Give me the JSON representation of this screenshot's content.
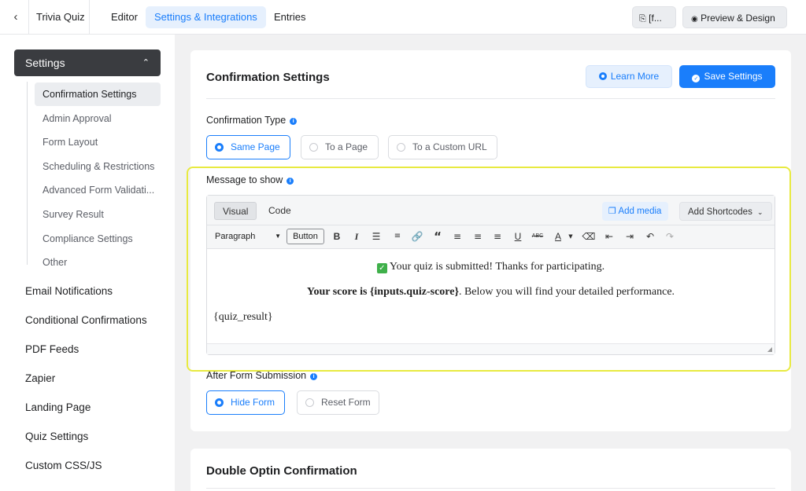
{
  "topbar": {
    "form_title": "Trivia Quiz",
    "nav": [
      "Editor",
      "Settings & Integrations",
      "Entries"
    ],
    "shortcode_btn": "[f...",
    "preview_btn": "Preview & Design"
  },
  "sidebar": {
    "settings_label": "Settings",
    "sub_items": [
      "Confirmation Settings",
      "Admin Approval",
      "Form Layout",
      "Scheduling & Restrictions",
      "Advanced Form Validati...",
      "Survey Result",
      "Compliance Settings",
      "Other"
    ],
    "main_items": [
      "Email Notifications",
      "Conditional Confirmations",
      "PDF Feeds",
      "Zapier",
      "Landing Page",
      "Quiz Settings",
      "Custom CSS/JS"
    ]
  },
  "confirmation": {
    "title": "Confirmation Settings",
    "learn_more": "Learn More",
    "save": "Save Settings",
    "type_label": "Confirmation Type",
    "type_options": [
      "Same Page",
      "To a Page",
      "To a Custom URL"
    ],
    "message_label": "Message to show",
    "after_label": "After Form Submission",
    "after_options": [
      "Hide Form",
      "Reset Form"
    ]
  },
  "editor": {
    "tab_visual": "Visual",
    "tab_code": "Code",
    "add_media": "Add media",
    "add_shortcodes": "Add Shortcodes",
    "paragraph": "Paragraph",
    "button": "Button",
    "line1": "Your quiz is submitted! Thanks for participating.",
    "line2_bold": "Your score is {inputs.quiz-score}",
    "line2_rest": ". Below you will find your detailed performance.",
    "line3": "{quiz_result}"
  },
  "double_optin": {
    "title": "Double Optin Confirmation"
  },
  "colors": {
    "accent": "#1a7efb",
    "highlight": "#e8ea40",
    "sidebar_active": "#3a3c40"
  }
}
